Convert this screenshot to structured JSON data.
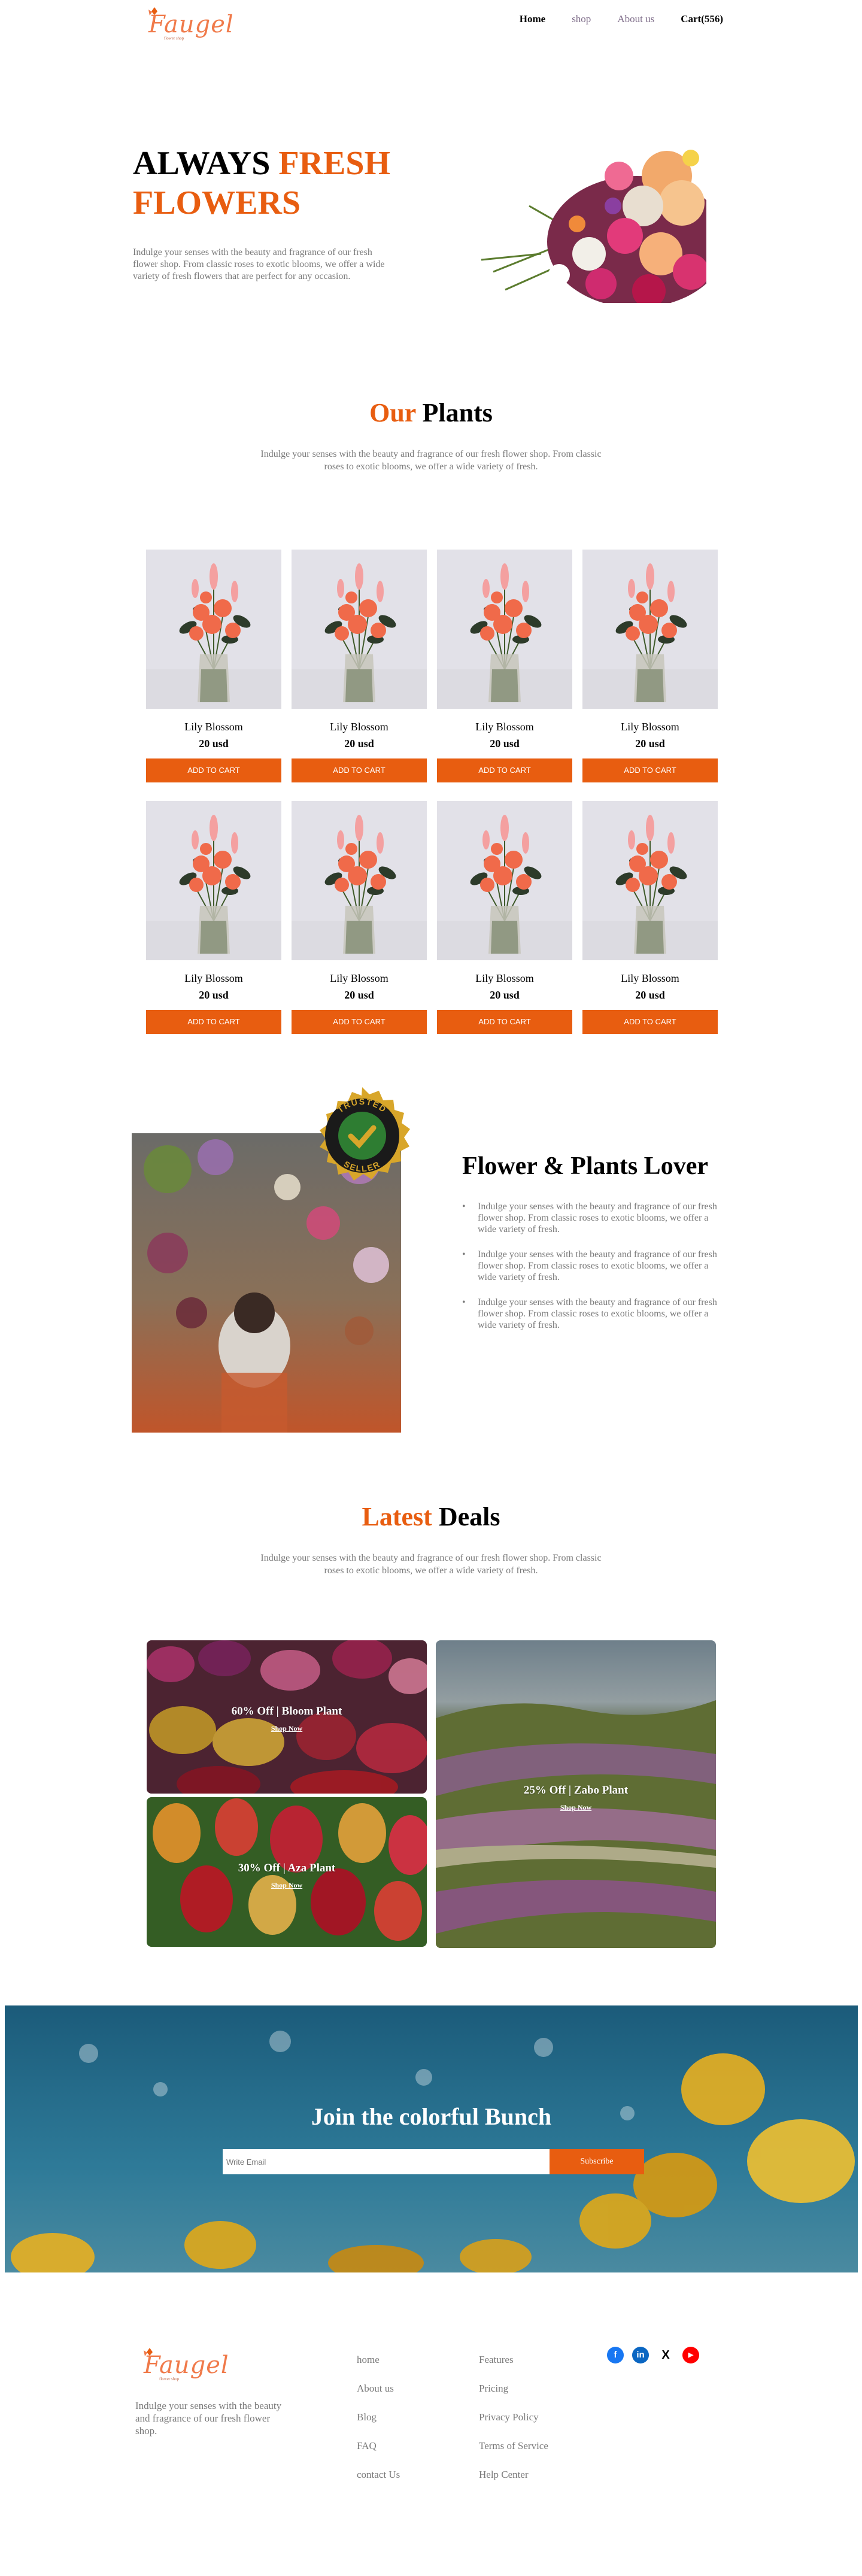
{
  "brand": {
    "name": "Faugel",
    "tagline": "flower shop"
  },
  "nav": {
    "home": "Home",
    "shop": "shop",
    "about": "About us",
    "cart": "Cart(556)"
  },
  "hero": {
    "title_black": "ALWAYS ",
    "title_orange": "FRESH FLOWERS",
    "description": "Indulge your senses with the beauty and fragrance of our fresh flower shop. From classic roses to exotic blooms, we offer a wide variety of fresh flowers that are perfect for any occasion."
  },
  "plants": {
    "title_orange": "Our",
    "title_black": " Plants",
    "description": "Indulge your senses with the beauty and fragrance of our fresh flower shop. From classic roses to exotic blooms, we offer a wide variety of fresh.",
    "products": [
      {
        "name": "Lily Blossom",
        "price": "20 usd",
        "button": "ADD TO CART"
      },
      {
        "name": "Lily Blossom",
        "price": "20 usd",
        "button": "ADD TO CART"
      },
      {
        "name": "Lily Blossom",
        "price": "20 usd",
        "button": "ADD TO CART"
      },
      {
        "name": "Lily Blossom",
        "price": "20 usd",
        "button": "ADD TO CART"
      },
      {
        "name": "Lily Blossom",
        "price": "20 usd",
        "button": "ADD TO CART"
      },
      {
        "name": "Lily Blossom",
        "price": "20 usd",
        "button": "ADD TO CART"
      },
      {
        "name": "Lily Blossom",
        "price": "20 usd",
        "button": "ADD TO CART"
      },
      {
        "name": "Lily Blossom",
        "price": "20 usd",
        "button": "ADD TO CART"
      }
    ]
  },
  "lover": {
    "badge_top": "TRUSTED",
    "badge_bottom": "SELLER",
    "title": "Flower & Plants Lover",
    "items": [
      "Indulge your senses with the beauty and fragrance of our fresh flower shop. From classic roses to exotic blooms, we offer a wide variety of fresh.",
      "Indulge your senses with the beauty and fragrance of our fresh flower shop. From classic roses to exotic blooms, we offer a wide variety of fresh.",
      "Indulge your senses with the beauty and fragrance of our fresh flower shop. From classic roses to exotic blooms, we offer a wide variety of fresh."
    ]
  },
  "deals": {
    "title_orange": "Latest",
    "title_black": " Deals",
    "description": "Indulge your senses with the beauty and fragrance of our fresh flower shop. From classic roses to exotic blooms, we offer a wide variety of fresh.",
    "cards": [
      {
        "title": "60% Off | Bloom Plant",
        "link": "Shop Now"
      },
      {
        "title": "30% Off | Aza Plant",
        "link": "Shop Now"
      },
      {
        "title": "25% Off | Zabo Plant",
        "link": "Shop Now"
      }
    ]
  },
  "join": {
    "title": "Join the colorful Bunch",
    "placeholder": "Write Email",
    "button": "Subscribe"
  },
  "footer": {
    "description": "Indulge your senses with the beauty and fragrance of our fresh flower shop.",
    "col1": [
      "home",
      "About us",
      "Blog",
      "FAQ",
      "contact Us"
    ],
    "col2": [
      "Features",
      "Pricing",
      "Privacy Policy",
      "Terms of Service",
      "Help Center"
    ],
    "social": [
      {
        "icon": "facebook-icon",
        "glyph": "f",
        "color": "#1877f2"
      },
      {
        "icon": "linkedin-icon",
        "glyph": "in",
        "color": "#0a66c2"
      },
      {
        "icon": "x-icon",
        "glyph": "X",
        "color": "#000000"
      },
      {
        "icon": "youtube-icon",
        "glyph": "▶",
        "color": "#ff0000"
      }
    ]
  },
  "colors": {
    "accent": "#e85d10",
    "muted_text": "#7a7a7a"
  }
}
